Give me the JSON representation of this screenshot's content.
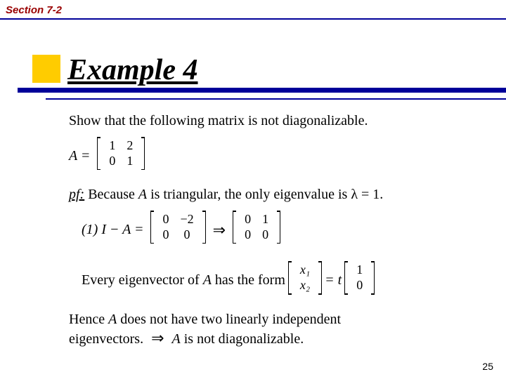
{
  "section_label": "Section 7-2",
  "title": "Example 4",
  "body": {
    "intro": "Show that the following matrix is not diagonalizable.",
    "A_label": "A =",
    "A": [
      [
        "1",
        "2"
      ],
      [
        "0",
        "1"
      ]
    ],
    "pf_label": "pf:",
    "pf_line1_a": " Because ",
    "pf_line1_b": " is triangular, the only eigenvalue is ",
    "lambda_eq": "λ = 1",
    "period": ".",
    "step_lhs": "(1) I − A =",
    "M1": [
      [
        "0",
        "−2"
      ],
      [
        "0",
        "0"
      ]
    ],
    "arrow": "⇒",
    "M2": [
      [
        "0",
        "1"
      ],
      [
        "0",
        "0"
      ]
    ],
    "eig_text_a": "Every eigenvector of ",
    "eig_text_b": " has the form ",
    "xvec": [
      [
        "x₁"
      ],
      [
        "x₂"
      ]
    ],
    "eq_t": " = t",
    "basis": [
      [
        "1"
      ],
      [
        "0"
      ]
    ],
    "concl1": "Hence ",
    "concl2": " does not have two linearly independent",
    "concl3": "eigenvectors. ",
    "concl4": " is not diagonalizable.",
    "A_sym": "A"
  },
  "page_number": "25"
}
